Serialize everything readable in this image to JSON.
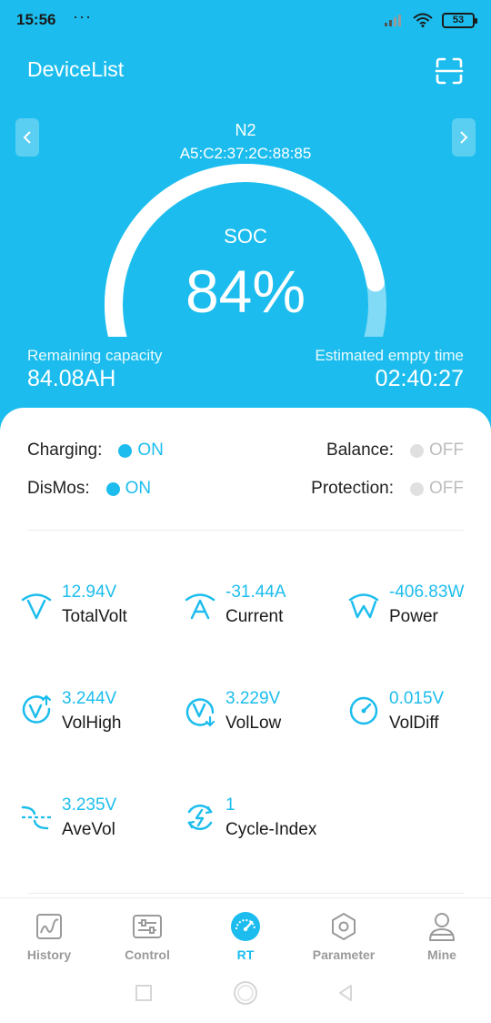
{
  "status_bar": {
    "time": "15:56",
    "dots": "···",
    "battery": "53"
  },
  "header": {
    "title": "DeviceList",
    "scan_icon": "scan-icon"
  },
  "device": {
    "name": "N2",
    "mac": "A5:C2:37:2C:88:85"
  },
  "soc": {
    "label": "SOC",
    "value": "84%",
    "fraction": 0.84
  },
  "remaining": {
    "label": "Remaining capacity",
    "value": "84.08AH"
  },
  "empty_time": {
    "label": "Estimated empty time",
    "value": "02:40:27"
  },
  "switches": {
    "charging": {
      "label": "Charging:",
      "state": "ON"
    },
    "balance": {
      "label": "Balance:",
      "state": "OFF"
    },
    "dismos": {
      "label": "DisMos:",
      "state": "ON"
    },
    "protection": {
      "label": "Protection:",
      "state": "OFF"
    }
  },
  "metrics": {
    "total_volt": {
      "value": "12.94V",
      "label": "TotalVolt",
      "icon": "voltage-icon"
    },
    "current": {
      "value": "-31.44A",
      "label": "Current",
      "icon": "current-icon"
    },
    "power": {
      "value": "-406.83W",
      "label": "Power",
      "icon": "power-icon"
    },
    "vol_high": {
      "value": "3.244V",
      "label": "VolHigh",
      "icon": "vol-high-icon"
    },
    "vol_low": {
      "value": "3.229V",
      "label": "VolLow",
      "icon": "vol-low-icon"
    },
    "vol_diff": {
      "value": "0.015V",
      "label": "VolDiff",
      "icon": "gauge-icon"
    },
    "ave_vol": {
      "value": "3.235V",
      "label": "AveVol",
      "icon": "average-icon"
    },
    "cycle_index": {
      "value": "1",
      "label": "Cycle-Index",
      "icon": "cycle-icon"
    }
  },
  "tabs": [
    {
      "label": "History",
      "icon": "chart-icon"
    },
    {
      "label": "Control",
      "icon": "sliders-icon"
    },
    {
      "label": "RT",
      "icon": "speedometer-icon"
    },
    {
      "label": "Parameter",
      "icon": "hex-nut-icon"
    },
    {
      "label": "Mine",
      "icon": "person-icon"
    }
  ],
  "colors": {
    "accent": "#1cbdee",
    "off": "#e0e0e0",
    "text": "#1a1a1a",
    "muted": "#9a9a9a"
  }
}
